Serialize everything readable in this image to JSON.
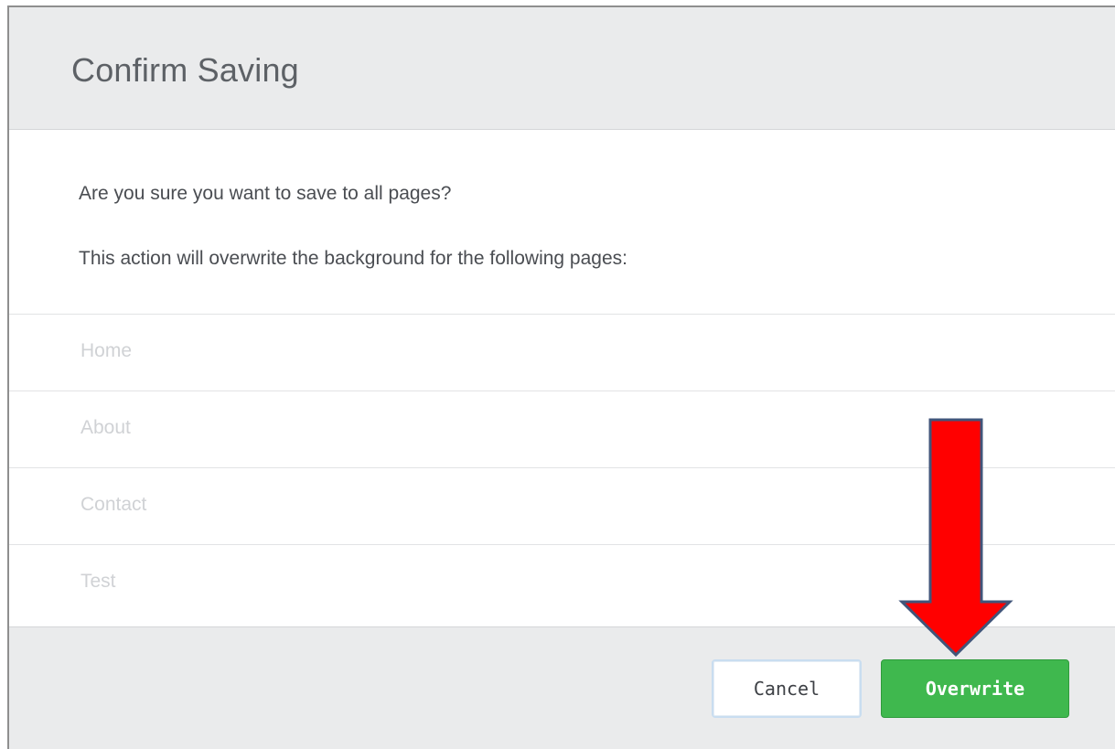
{
  "dialog": {
    "title": "Confirm Saving",
    "message_question": "Are you sure you want to save to all pages?",
    "message_detail": "This action will overwrite the background for the following pages:",
    "pages": [
      "Home",
      "About",
      "Contact",
      "Test"
    ],
    "cancel_label": "Cancel",
    "overwrite_label": "Overwrite"
  },
  "colors": {
    "header_bg": "#eaebec",
    "primary_button": "#3fb84e",
    "annotation_arrow": "#ff0000",
    "annotation_arrow_outline": "#41557a"
  },
  "annotation": {
    "icon": "down-arrow-icon"
  }
}
